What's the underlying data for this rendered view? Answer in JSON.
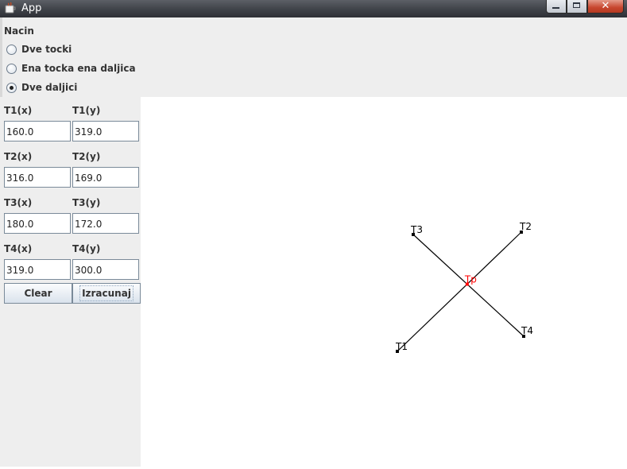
{
  "window": {
    "title": "App",
    "close_glyph": "✕"
  },
  "method": {
    "label": "Nacin",
    "options": [
      "Dve tocki",
      "Ena tocka ena daljica",
      "Dve daljici"
    ],
    "selected": "Dve daljici"
  },
  "points": {
    "t1x_label": "T1(x)",
    "t1y_label": "T1(y)",
    "t1x": "160.0",
    "t1y": "319.0",
    "t2x_label": "T2(x)",
    "t2y_label": "T2(y)",
    "t2x": "316.0",
    "t2y": "169.0",
    "t3x_label": "T3(x)",
    "t3y_label": "T3(y)",
    "t3x": "180.0",
    "t3y": "172.0",
    "t4x_label": "T4(x)",
    "t4y_label": "T4(y)",
    "t4x": "319.0",
    "t4y": "300.0"
  },
  "buttons": {
    "clear": "Clear",
    "compute": "Izracunaj"
  },
  "drawing": {
    "labels": {
      "t1": "T1",
      "t2": "T2",
      "t3": "T3",
      "t4": "T4",
      "intersection": "Tp"
    },
    "line_color": "#000000",
    "intersection_color": "#ff0000"
  }
}
